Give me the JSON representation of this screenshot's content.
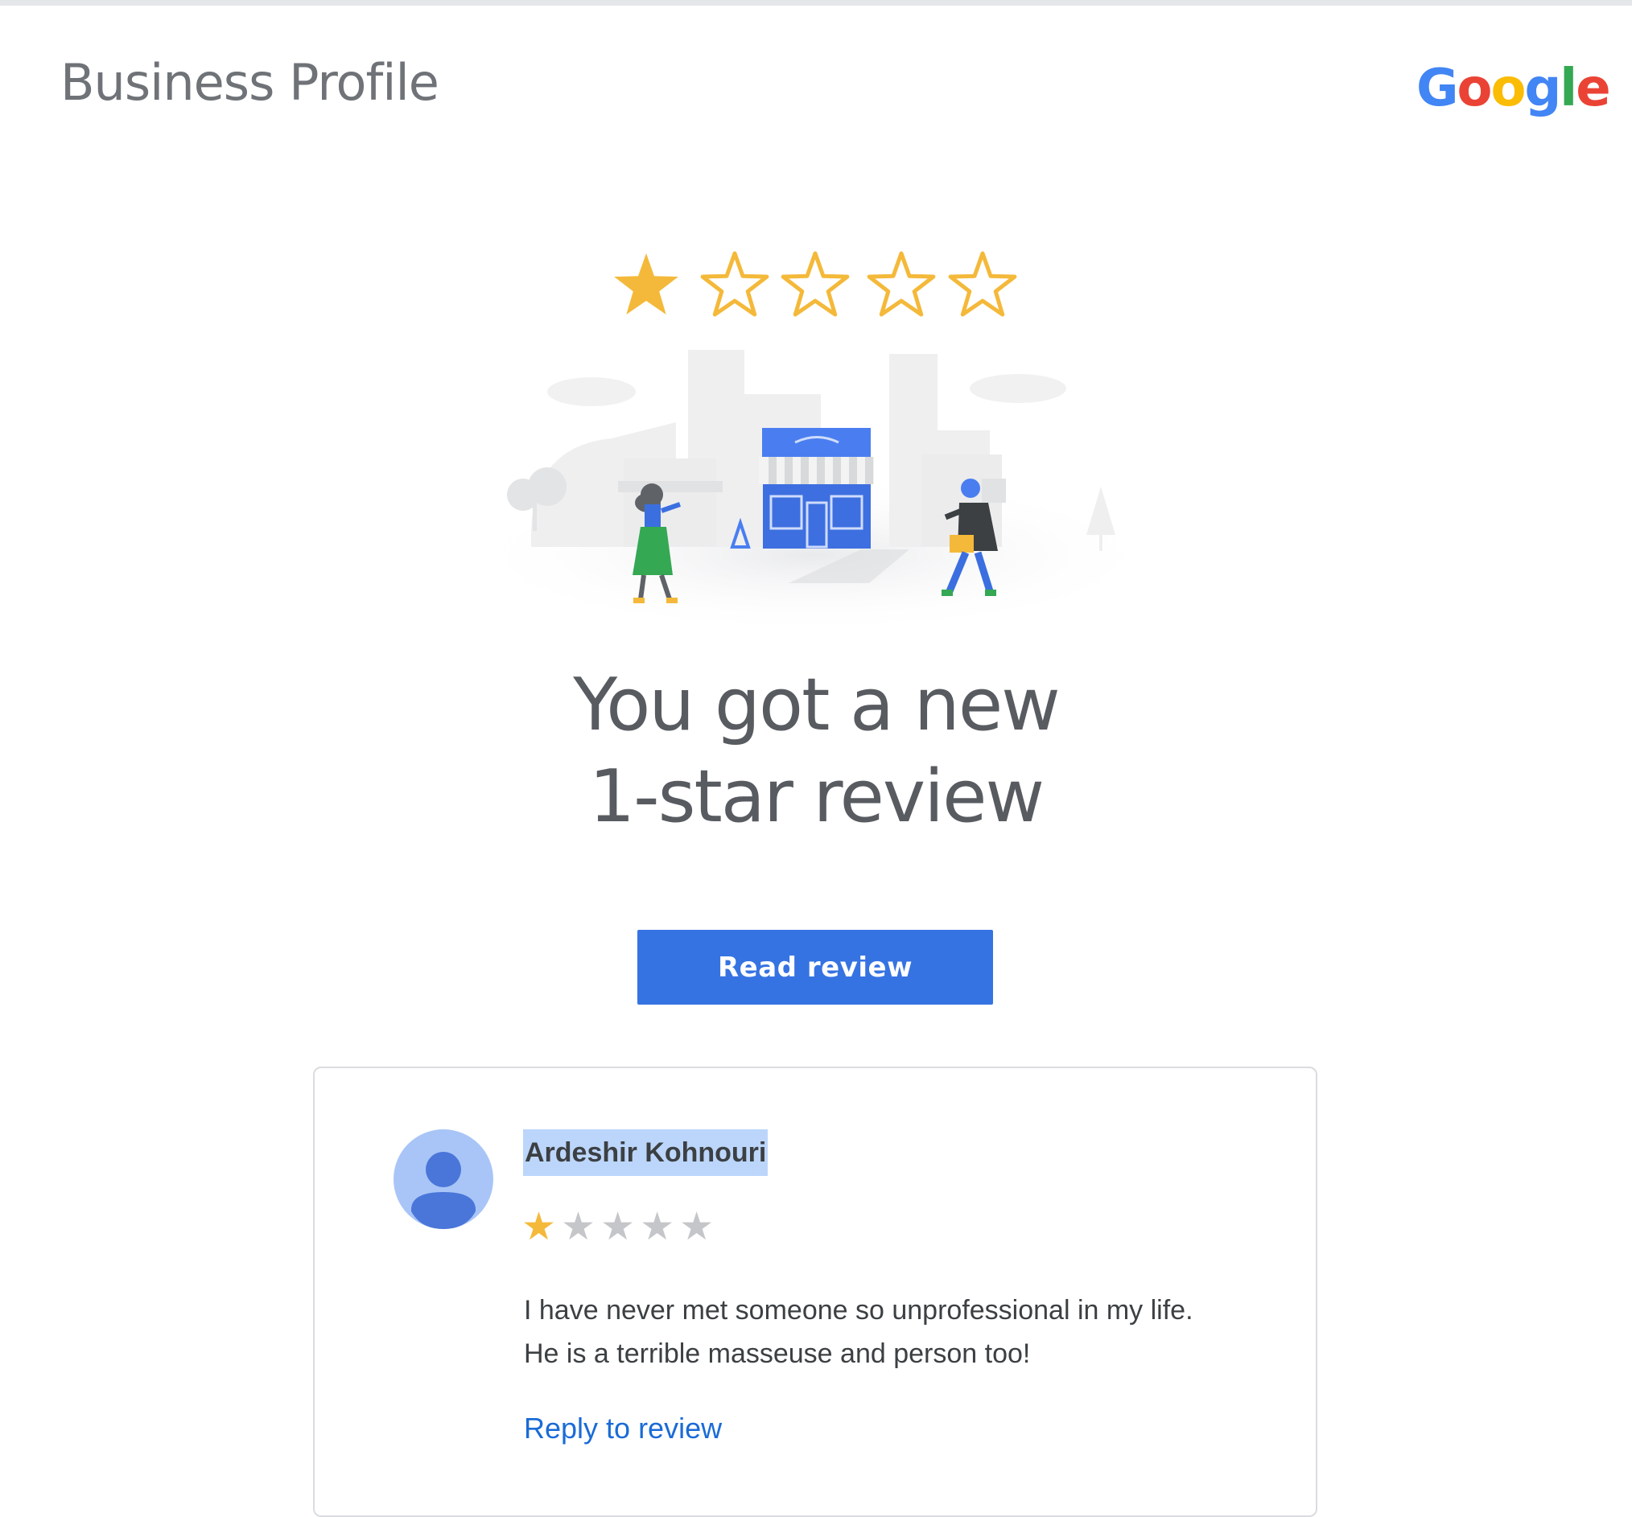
{
  "header": {
    "brand_title": "Business Profile",
    "logo_letters": [
      {
        "char": "G",
        "color": "#4285F4"
      },
      {
        "char": "o",
        "color": "#EA4335"
      },
      {
        "char": "o",
        "color": "#FBBC05"
      },
      {
        "char": "g",
        "color": "#4285F4"
      },
      {
        "char": "l",
        "color": "#34A853"
      },
      {
        "char": "e",
        "color": "#EA4335"
      }
    ]
  },
  "rating": {
    "value": 1,
    "max": 5,
    "filled_color": "#F4B93A",
    "empty_small_color": "#C4C6C9"
  },
  "hero": {
    "illustration": "storefront-with-pedestrians-illustration",
    "headline_line1": "You got a new",
    "headline_line2": "1-star review"
  },
  "cta": {
    "read_review_label": "Read review",
    "color": "#3673E2"
  },
  "review": {
    "reviewer_name": "Ardeshir Kohnouri",
    "avatar_icon": "person-avatar-icon",
    "text_line1": "I have never met someone so unprofessional in my life.",
    "text_line2": "He is a terrible masseuse and person too!",
    "reply_label": "Reply to review"
  }
}
